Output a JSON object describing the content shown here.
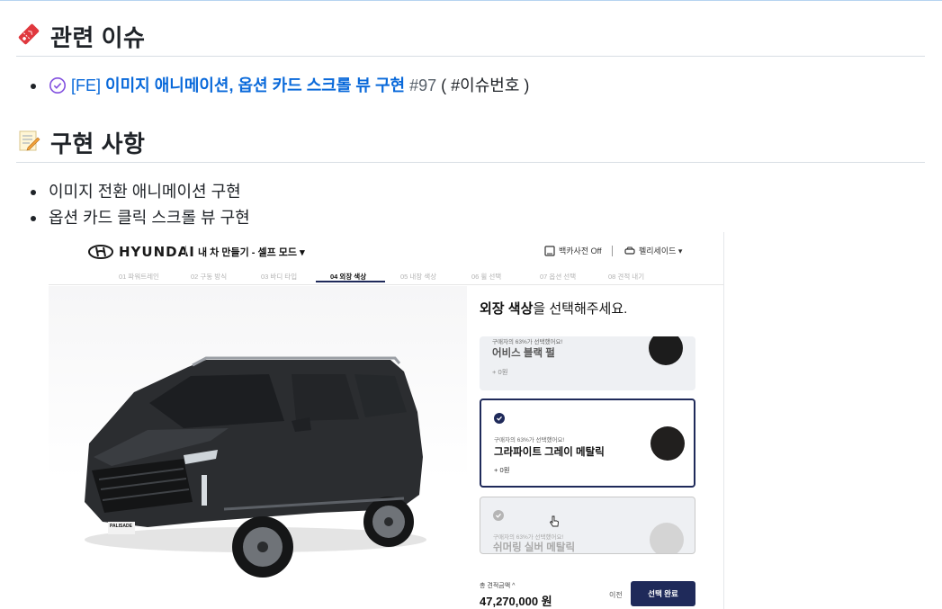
{
  "section_issue": {
    "title": "관련 이슈",
    "items": [
      {
        "prefix": "[FE]",
        "title": " 이미지 애니메이션, 옵션 카드 스크롤 뷰 구현",
        "number": " #97",
        "suffix": " ( #이슈번호 )"
      }
    ]
  },
  "section_impl": {
    "title": "구현 사항",
    "items": [
      "이미지 전환 애니메이션 구현",
      "옵션 카드 클릭 스크롤 뷰 구현"
    ]
  },
  "screenshot": {
    "brand": "HYUNDAI",
    "header_title": "내 차 만들기 - 셀프 모드 ▾",
    "dict_label": "백카사전 Off",
    "model_label": "펠리세이드 ▾",
    "steps": [
      "01 파워트레인",
      "02 구동 방식",
      "03 바디 타입",
      "04 외장 색상",
      "05 내장 색상",
      "06 휠 선택",
      "07 옵션 선택",
      "08 견적 내기"
    ],
    "active_step": 3,
    "car_plate": "PALISADE",
    "panel_title_bold": "외장 색상",
    "panel_title_rest": "을 선택해주세요.",
    "cards": [
      {
        "share": "구매자의 63%가 선택했어요!",
        "name": "어비스 블랙 펄",
        "price": "+ 0원",
        "swatch": "#1c1c1c"
      },
      {
        "share": "구매자의 63%가 선택했어요!",
        "name": "그라파이트 그레이 메탈릭",
        "price": "+ 0원",
        "swatch": "#211f1e"
      },
      {
        "share": "구매자의 63%가 선택했어요!",
        "name": "쉬머링 실버 메탈릭",
        "price": "",
        "swatch": "#d4d4d4"
      }
    ],
    "total_label": "총 견적금액 ^",
    "total_price": "47,270,000 원",
    "prev_label": "이전",
    "select_label": "선택 완료"
  },
  "colors": {
    "link": "#0969da",
    "navy": "#1f2a5a"
  }
}
